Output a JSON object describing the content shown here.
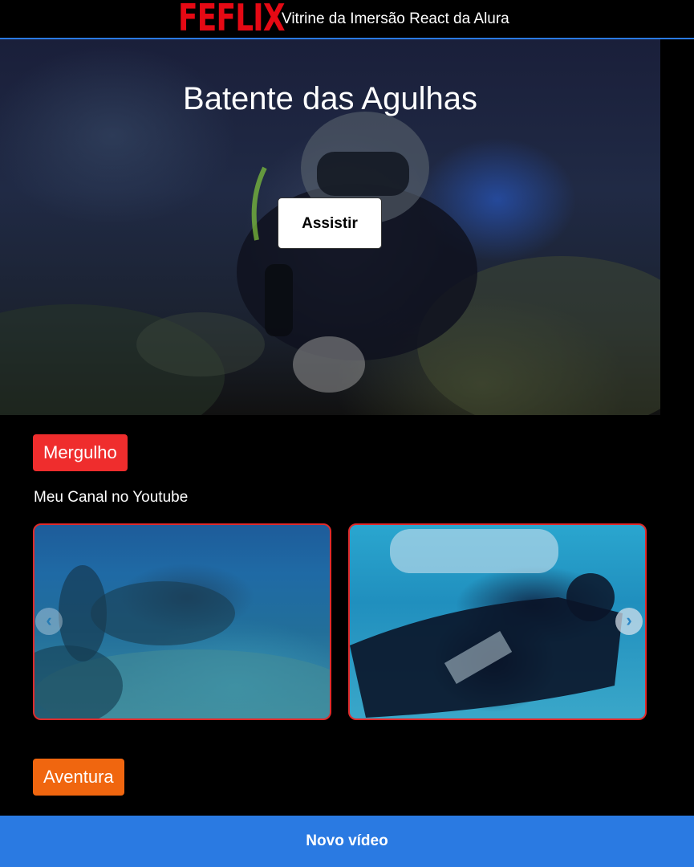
{
  "header": {
    "logo": "FEFLIX",
    "tagline": "Vitrine da Imersão React da Alura"
  },
  "hero": {
    "title": "Batente das Agulhas",
    "watch_label": "Assistir"
  },
  "categories": [
    {
      "title": "Mergulho",
      "color": "#ef2d2d",
      "description": "Meu Canal no Youtube",
      "videos": [
        {
          "thumbnail": "underwater-reef"
        },
        {
          "thumbnail": "scuba-diver"
        }
      ]
    },
    {
      "title": "Aventura",
      "color": "#f0660f"
    }
  ],
  "carousel": {
    "prev_icon": "chevron-left-icon",
    "next_icon": "chevron-right-icon",
    "prev_glyph": "‹",
    "next_glyph": "›"
  },
  "footer": {
    "new_video_label": "Novo vídeo"
  },
  "colors": {
    "brand": "#e50914",
    "accent": "#2a7ae2"
  }
}
